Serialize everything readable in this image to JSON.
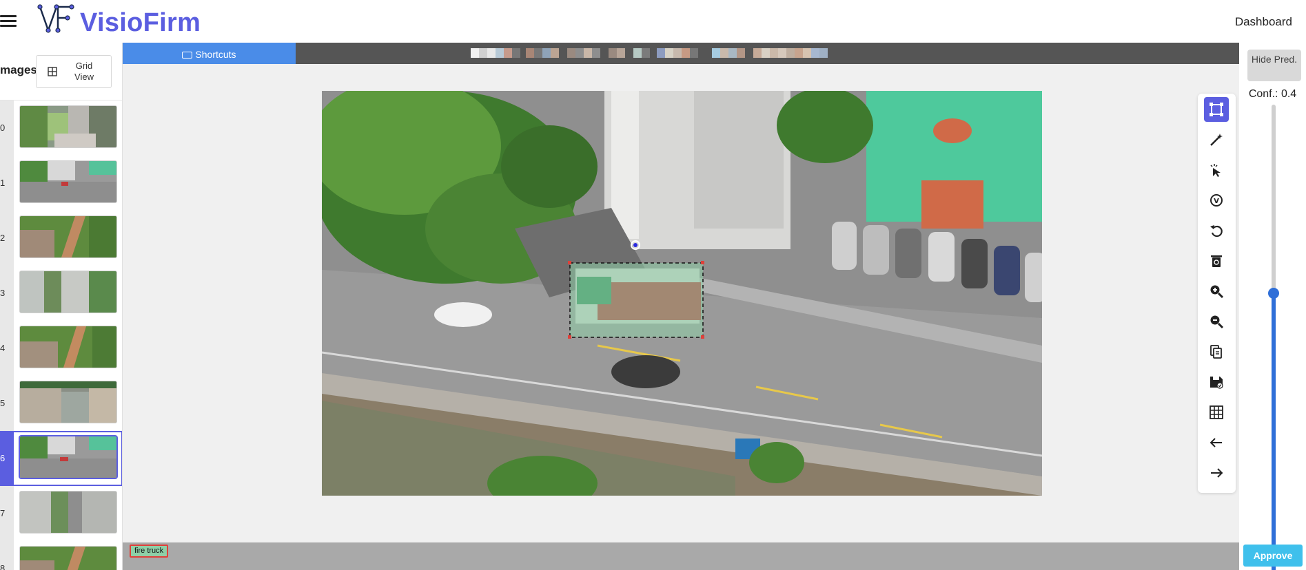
{
  "app": {
    "brand": "VisioFirm",
    "logo_text": "VF",
    "dashboard_label": "Dashboard"
  },
  "sidebar": {
    "title": "mages",
    "grid_view_label": "Grid View",
    "items": [
      {
        "num": "0",
        "active": false
      },
      {
        "num": "1",
        "active": false
      },
      {
        "num": "2",
        "active": false
      },
      {
        "num": "3",
        "active": false
      },
      {
        "num": "4",
        "active": false
      },
      {
        "num": "5",
        "active": false
      },
      {
        "num": "6",
        "active": true
      },
      {
        "num": "7",
        "active": false
      },
      {
        "num": "8",
        "active": false
      }
    ]
  },
  "toolbar": {
    "shortcuts_label": "Shortcuts"
  },
  "tools": [
    {
      "icon": "bounding-box-icon",
      "active": true
    },
    {
      "icon": "magic-wand-icon",
      "active": false
    },
    {
      "icon": "click-select-icon",
      "active": false
    },
    {
      "icon": "auto-detect-icon",
      "active": false
    },
    {
      "icon": "undo-icon",
      "active": false
    },
    {
      "icon": "trash-icon",
      "active": false
    },
    {
      "icon": "zoom-in-icon",
      "active": false
    },
    {
      "icon": "zoom-out-icon",
      "active": false
    },
    {
      "icon": "copy-icon",
      "active": false
    },
    {
      "icon": "save-icon",
      "active": false
    },
    {
      "icon": "grid-icon",
      "active": false
    },
    {
      "icon": "arrow-left-icon",
      "active": false
    },
    {
      "icon": "arrow-right-icon",
      "active": false
    }
  ],
  "predictions": {
    "hide_label": "Hide Pred.",
    "conf_label": "Conf.: 0.4",
    "conf_value": 0.4
  },
  "annotation": {
    "label": "fire truck",
    "color": "#8fcfa7",
    "border_color": "#e0403a"
  },
  "actions": {
    "approve_label": "Approve"
  },
  "colors": {
    "accent": "#5b5ee0",
    "shortcuts": "#4a8ce8",
    "approve": "#3fc0ec",
    "slider": "#2f6fd8"
  }
}
